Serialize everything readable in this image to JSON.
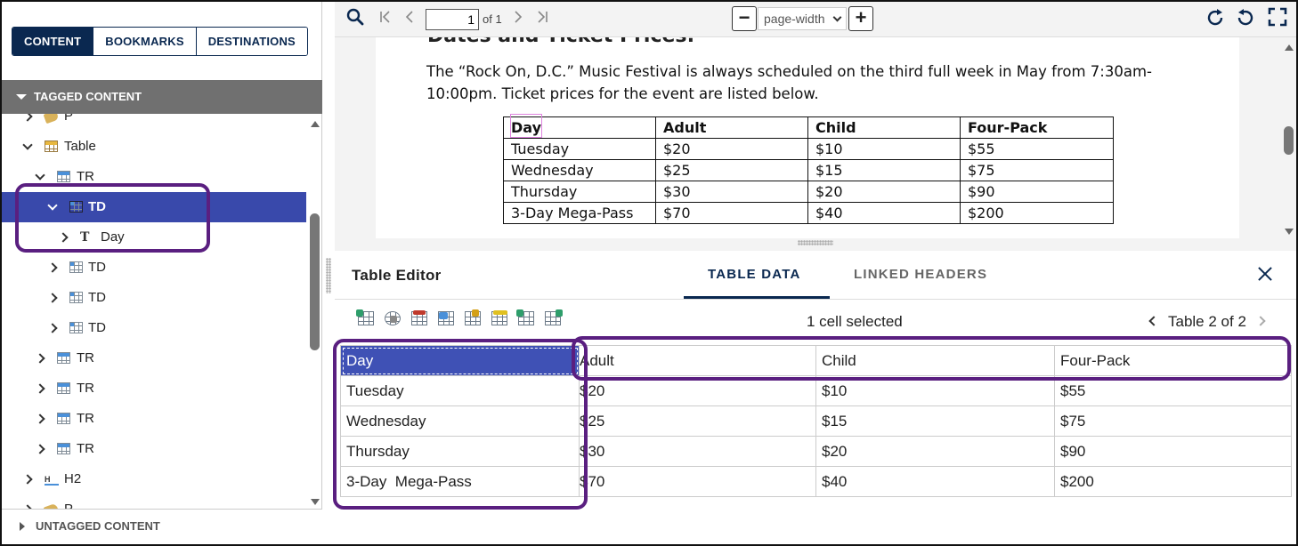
{
  "left_panel": {
    "tabs": [
      {
        "label": "CONTENT",
        "active": true
      },
      {
        "label": "BOOKMARKS",
        "active": false
      },
      {
        "label": "DESTINATIONS",
        "active": false
      }
    ],
    "tagged_header": "TAGGED CONTENT",
    "untagged_header": "UNTAGGED CONTENT",
    "tree": [
      {
        "label": "P",
        "icon": "tag-icon",
        "expander": "collapsed"
      },
      {
        "label": "Table",
        "icon": "table-icon",
        "expander": "expanded"
      },
      {
        "label": "TR",
        "icon": "table-row-icon",
        "expander": "expanded"
      },
      {
        "label": "TD",
        "icon": "table-cell-icon",
        "expander": "expanded",
        "selected": true
      },
      {
        "label": "Day",
        "icon": "text-icon",
        "expander": "collapsed"
      },
      {
        "label": "TD",
        "icon": "table-cell-icon",
        "expander": "collapsed"
      },
      {
        "label": "TD",
        "icon": "table-cell-icon",
        "expander": "collapsed"
      },
      {
        "label": "TD",
        "icon": "table-cell-icon",
        "expander": "collapsed"
      },
      {
        "label": "TR",
        "icon": "table-row-icon",
        "expander": "collapsed"
      },
      {
        "label": "TR",
        "icon": "table-row-icon",
        "expander": "collapsed"
      },
      {
        "label": "TR",
        "icon": "table-row-icon",
        "expander": "collapsed"
      },
      {
        "label": "TR",
        "icon": "table-row-icon",
        "expander": "collapsed"
      },
      {
        "label": "H2",
        "icon": "heading-icon",
        "expander": "collapsed"
      },
      {
        "label": "P",
        "icon": "tag-icon",
        "expander": "collapsed"
      }
    ],
    "h2_icon_text": "H",
    "text_icon_text": "T"
  },
  "viewer": {
    "page_number": "1",
    "page_of": "of 1",
    "zoom": "page-width",
    "zoom_out_label": "−",
    "zoom_in_label": "+",
    "doc_heading_cut": "Dates and Ticket Prices:",
    "doc_paragraph": "The “Rock On, D.C.” Music Festival is always scheduled on the third full week in May from 7:30am-10:00pm. Ticket prices for the event are listed below.",
    "doc_table": {
      "header": [
        "Day",
        "Adult",
        "Child",
        "Four-Pack"
      ],
      "rows": [
        [
          "Tuesday",
          "$20",
          "$10",
          "$55"
        ],
        [
          "Wednesday",
          "$25",
          "$15",
          "$75"
        ],
        [
          "Thursday",
          "$30",
          "$20",
          "$90"
        ],
        [
          "3-Day Mega-Pass",
          "$70",
          "$40",
          "$200"
        ]
      ]
    }
  },
  "editor": {
    "title": "Table Editor",
    "tab_table_data": "TABLE DATA",
    "tab_linked_headers": "LINKED HEADERS",
    "selection": "1 cell selected",
    "table_nav": "Table 2 of 2",
    "tools": [
      "insert-column-icon",
      "cell-properties-icon",
      "header-scope-icon",
      "merge-cells-icon",
      "split-cells-icon",
      "set-header-icon",
      "insert-row-icon",
      "add-table-icon"
    ],
    "grid": {
      "header": [
        "Day",
        "Adult",
        "Child",
        "Four-Pack"
      ],
      "rows": [
        [
          "Tuesday",
          "$20",
          "$10",
          "$55"
        ],
        [
          "Wednesday",
          "$25",
          "$15",
          "$75"
        ],
        [
          "Thursday",
          "$30",
          "$20",
          "$90"
        ],
        [
          "3-Day  Mega-Pass",
          "$70",
          "$40",
          "$200"
        ]
      ]
    }
  },
  "colors": {
    "navy": "#0a2850",
    "selection": "#3949ab",
    "highlight_outline": "#5a1f80",
    "section_header": "#707070"
  }
}
